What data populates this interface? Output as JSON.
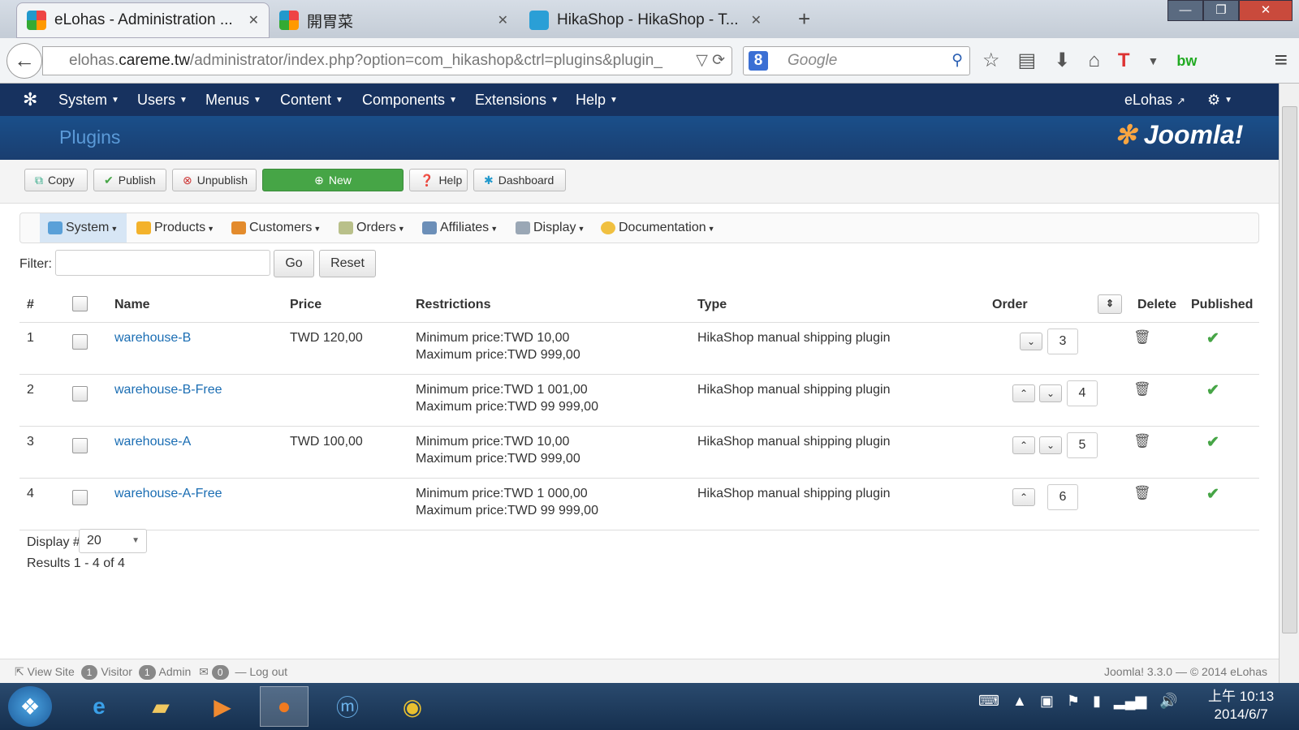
{
  "browser": {
    "tabs": [
      {
        "title": "eLohas - Administration ...",
        "close": "✕",
        "active": true
      },
      {
        "title": "開胃菜",
        "close": "✕",
        "active": false
      },
      {
        "title": "HikaShop - HikaShop - T...",
        "close": "✕",
        "active": false
      }
    ],
    "new_tab": "+",
    "url_prefix": "elohas.",
    "url_host": "careme.tw",
    "url_path": "/administrator/index.php?option=com_hikashop&ctrl=plugins&plugin_",
    "search_placeholder": "Google",
    "search_engine_letter": "8"
  },
  "joomla_nav": {
    "items": [
      "System",
      "Users",
      "Menus",
      "Content",
      "Components",
      "Extensions",
      "Help"
    ],
    "user": "eLohas"
  },
  "page_title": "Plugins",
  "logo_text": "Joomla!",
  "toolbar": {
    "copy": "Copy",
    "publish": "Publish",
    "unpublish": "Unpublish",
    "new": "New",
    "help": "Help",
    "dashboard": "Dashboard"
  },
  "hikashop_menu": [
    "System",
    "Products",
    "Customers",
    "Orders",
    "Affiliates",
    "Display",
    "Documentation"
  ],
  "filter": {
    "label": "Filter:",
    "value": "",
    "go": "Go",
    "reset": "Reset"
  },
  "table": {
    "headers": {
      "num": "#",
      "name": "Name",
      "price": "Price",
      "restrictions": "Restrictions",
      "type": "Type",
      "order": "Order",
      "delete": "Delete",
      "published": "Published"
    },
    "rows": [
      {
        "num": "1",
        "name": "warehouse-B",
        "price": "TWD 120,00",
        "min": "Minimum price:TWD 10,00",
        "max": "Maximum price:TWD 999,00",
        "type": "HikaShop manual shipping plugin",
        "order": "3"
      },
      {
        "num": "2",
        "name": "warehouse-B-Free",
        "price": "",
        "min": "Minimum price:TWD 1 001,00",
        "max": "Maximum price:TWD 99 999,00",
        "type": "HikaShop manual shipping plugin",
        "order": "4"
      },
      {
        "num": "3",
        "name": "warehouse-A",
        "price": "TWD 100,00",
        "min": "Minimum price:TWD 10,00",
        "max": "Maximum price:TWD 999,00",
        "type": "HikaShop manual shipping plugin",
        "order": "5"
      },
      {
        "num": "4",
        "name": "warehouse-A-Free",
        "price": "",
        "min": "Minimum price:TWD 1 000,00",
        "max": "Maximum price:TWD 99 999,00",
        "type": "HikaShop manual shipping plugin",
        "order": "6"
      }
    ]
  },
  "pager": {
    "label": "Display #",
    "value": "20",
    "results": "Results 1 - 4 of 4"
  },
  "status": {
    "view_site": "View Site",
    "visitor_count": "1",
    "visitor": "Visitor",
    "admin_count": "1",
    "admin": "Admin",
    "msg_count": "0",
    "logout": "Log out",
    "version": "Joomla! 3.3.0 — © 2014 eLohas"
  },
  "clock": {
    "time": "上午 10:13",
    "date": "2014/6/7"
  }
}
